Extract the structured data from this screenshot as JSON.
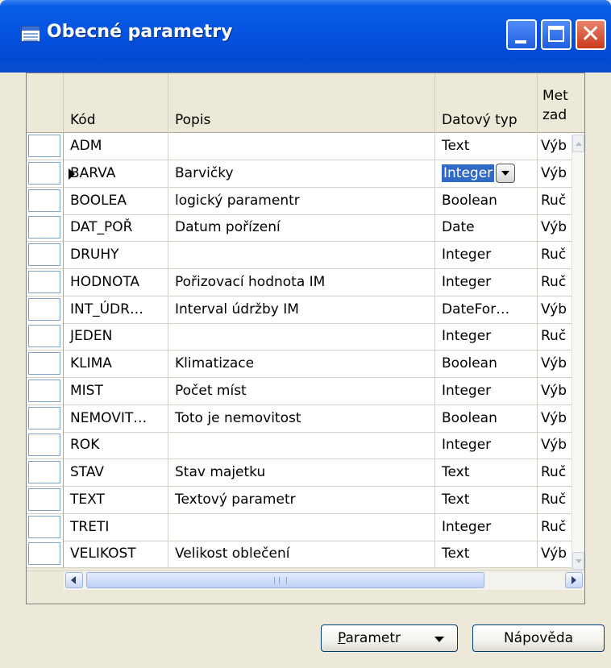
{
  "window": {
    "title": "Obecné parametry",
    "minimize": "minimize",
    "maximize": "maximize",
    "close": "close"
  },
  "grid": {
    "columns": {
      "kod": "Kód",
      "popis": "Popis",
      "datovy_typ": "Datový typ",
      "met_line1": "Met",
      "met_line2": "zad"
    },
    "selected_row": 1,
    "rows": [
      {
        "kod": "ADM",
        "popis": "",
        "typ": "Text",
        "met": "Výb"
      },
      {
        "kod": "BARVA",
        "popis": "Barvičky",
        "typ": "Integer",
        "met": "Výb"
      },
      {
        "kod": "BOOLEA",
        "popis": "logický paramentr",
        "typ": "Boolean",
        "met": "Ruč"
      },
      {
        "kod": "DAT_POŘ",
        "popis": "Datum pořízení",
        "typ": "Date",
        "met": "Výb"
      },
      {
        "kod": "DRUHY",
        "popis": "",
        "typ": "Integer",
        "met": "Ruč"
      },
      {
        "kod": "HODNOTA",
        "popis": "Pořizovací hodnota IM",
        "typ": "Integer",
        "met": "Ruč"
      },
      {
        "kod": "INT_ÚDR…",
        "popis": "Interval údržby IM",
        "typ": "DateFor…",
        "met": "Výb"
      },
      {
        "kod": "JEDEN",
        "popis": "",
        "typ": "Integer",
        "met": "Ruč"
      },
      {
        "kod": "KLIMA",
        "popis": "Klimatizace",
        "typ": "Boolean",
        "met": "Výb"
      },
      {
        "kod": "MIST",
        "popis": "Počet míst",
        "typ": "Integer",
        "met": "Výb"
      },
      {
        "kod": "NEMOVIT…",
        "popis": "Toto je nemovitost",
        "typ": "Boolean",
        "met": "Výb"
      },
      {
        "kod": "ROK",
        "popis": "",
        "typ": "Integer",
        "met": "Výb"
      },
      {
        "kod": "STAV",
        "popis": "Stav majetku",
        "typ": "Text",
        "met": "Ruč"
      },
      {
        "kod": "TEXT",
        "popis": "Textový parametr",
        "typ": "Text",
        "met": "Ruč"
      },
      {
        "kod": "TRETI",
        "popis": "",
        "typ": "Integer",
        "met": "Ruč"
      },
      {
        "kod": "VELIKOST",
        "popis": "Velikost oblečení",
        "typ": "Text",
        "met": "Výb"
      }
    ]
  },
  "buttons": {
    "parametr_access": "P",
    "parametr_rest": "arametr",
    "napoveda": "Nápověda"
  },
  "icons": {
    "window": "table-icon",
    "row_marker": "row-pointer-icon",
    "dropdown": "dropdown-arrow-icon"
  }
}
